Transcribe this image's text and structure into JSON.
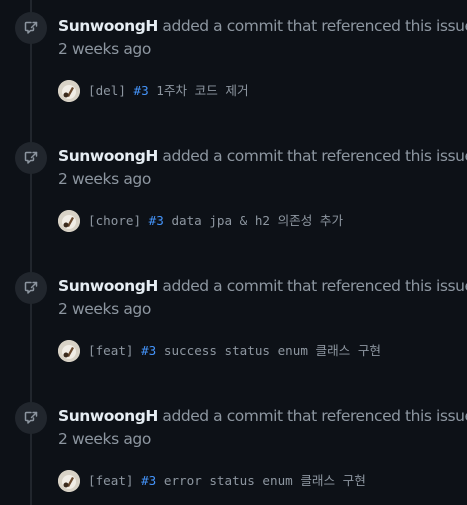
{
  "events": [
    {
      "author": "SunwoongH",
      "action": "added a commit that referenced this issue",
      "time": "2 weeks ago",
      "commit": {
        "prefix": "[del]",
        "ref": "#3",
        "message": "1주차 코드 제거"
      }
    },
    {
      "author": "SunwoongH",
      "action": "added a commit that referenced this issue",
      "time": "2 weeks ago",
      "commit": {
        "prefix": "[chore]",
        "ref": "#3",
        "message": "data jpa & h2 의존성 추가"
      }
    },
    {
      "author": "SunwoongH",
      "action": "added a commit that referenced this issue",
      "time": "2 weeks ago",
      "commit": {
        "prefix": "[feat]",
        "ref": "#3",
        "message": "success status enum 클래스 구현"
      }
    },
    {
      "author": "SunwoongH",
      "action": "added a commit that referenced this issue",
      "time": "2 weeks ago",
      "commit": {
        "prefix": "[feat]",
        "ref": "#3",
        "message": "error status enum 클래스 구현"
      }
    }
  ],
  "icons": {
    "event_badge": "cross-reference-icon",
    "avatar": "user-avatar"
  },
  "colors": {
    "background": "#0d1117",
    "author": "#e6edf3",
    "muted": "#8d96a0",
    "link": "#4493f8",
    "badge": "#21262d"
  }
}
